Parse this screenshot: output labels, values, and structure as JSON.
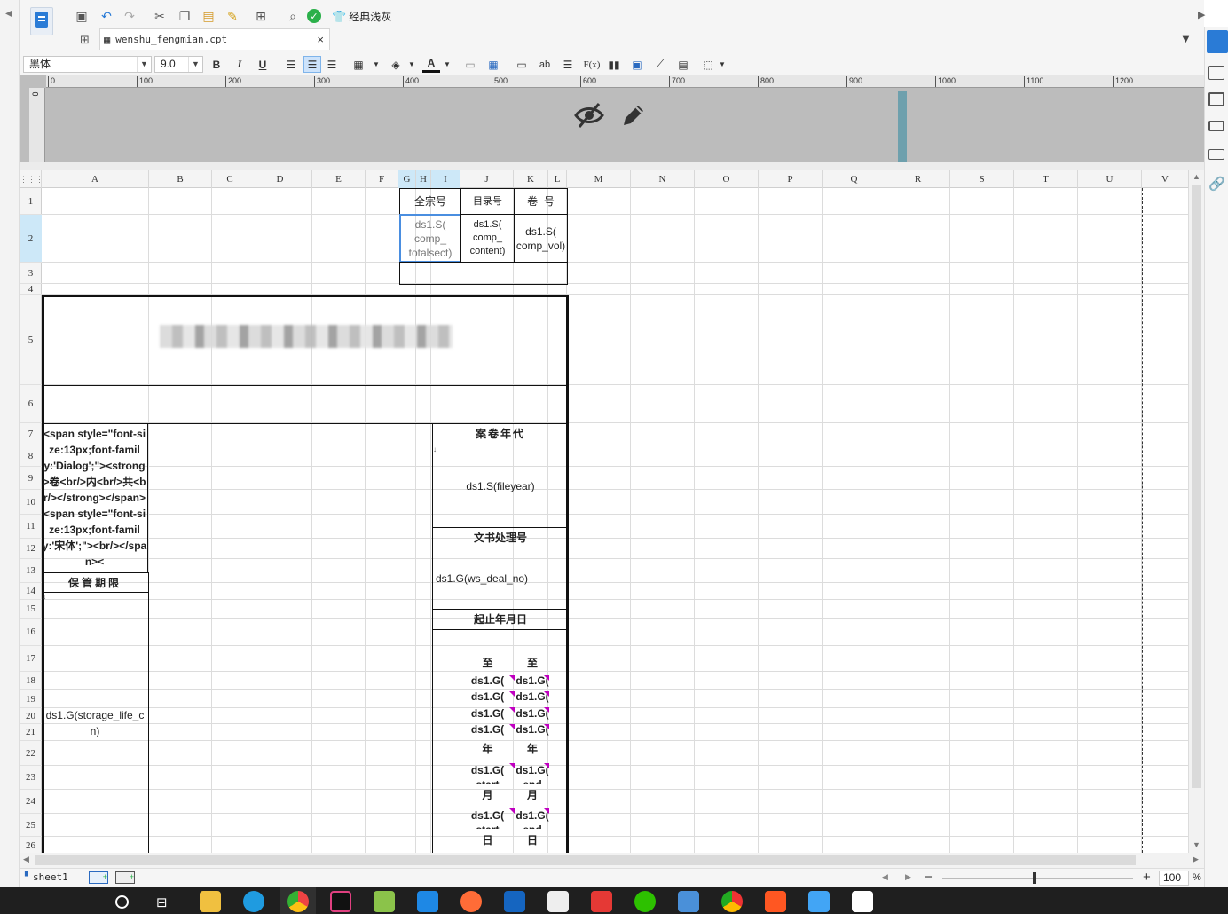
{
  "app": {
    "theme_label": "经典浅灰",
    "file_tab": "wenshu_fengmian.cpt"
  },
  "format": {
    "font_name": "黑体",
    "font_size": "9.0",
    "bold": "B",
    "italic": "I",
    "underline": "U",
    "fx": "F(x)",
    "ab": "ab"
  },
  "ruler": {
    "ticks": [
      "0",
      "100",
      "200",
      "300",
      "400",
      "500",
      "600",
      "700",
      "800",
      "900",
      "1000",
      "1100",
      "1200"
    ],
    "vzero": "0"
  },
  "grid": {
    "columns": [
      "A",
      "B",
      "C",
      "D",
      "E",
      "F",
      "G",
      "H",
      "I",
      "J",
      "K",
      "L",
      "M",
      "N",
      "O",
      "P",
      "Q",
      "R",
      "S",
      "T",
      "U",
      "V"
    ],
    "rows": [
      "1",
      "2",
      "3",
      "4",
      "5",
      "6",
      "7",
      "8",
      "9",
      "10",
      "11",
      "12",
      "13",
      "14",
      "15",
      "16",
      "17",
      "18",
      "19",
      "20",
      "21",
      "22",
      "23",
      "24",
      "25",
      "26"
    ],
    "cells": {
      "quanzonghao": "全宗号",
      "mulu": "目录号",
      "juanhao": "卷  号",
      "totalsect": "ds1.S(\ncomp_\ntotalsect)",
      "content": "ds1.S(\ncomp_\ncontent)",
      "vol": "ds1.S(\ncomp_vol)",
      "html_text": "<span style=\"font-size:13px;font-family:'Dialog';\"><strong>卷<br/>内<br/>共<br/></strong></span><span style=\"font-size:13px;font-family:'宋体';\"><br/></span><",
      "baoguan": "保管期限",
      "storage": "ds1.G(storage_life_cn)",
      "anjuan_niandai": "案卷年代",
      "fileyear": "ds1.S(fileyear)",
      "wenshu_hao": "文书处理号",
      "deal_no": "ds1.G(ws_deal_no)",
      "qizhi": "起止年月日",
      "zhi": "至",
      "dsg": "ds1.G(",
      "nian": "年",
      "yue": "月",
      "ri": "日",
      "start_frag": "start",
      "end_frag": "end"
    }
  },
  "sheet": {
    "name": "sheet1"
  },
  "zoom": {
    "value": "100",
    "unit": "%"
  },
  "colors": {
    "accent": "#2a7bd6",
    "selection": "#cde8f8",
    "split": "#6ea0ad",
    "taskbar": "#1f1f1f"
  }
}
